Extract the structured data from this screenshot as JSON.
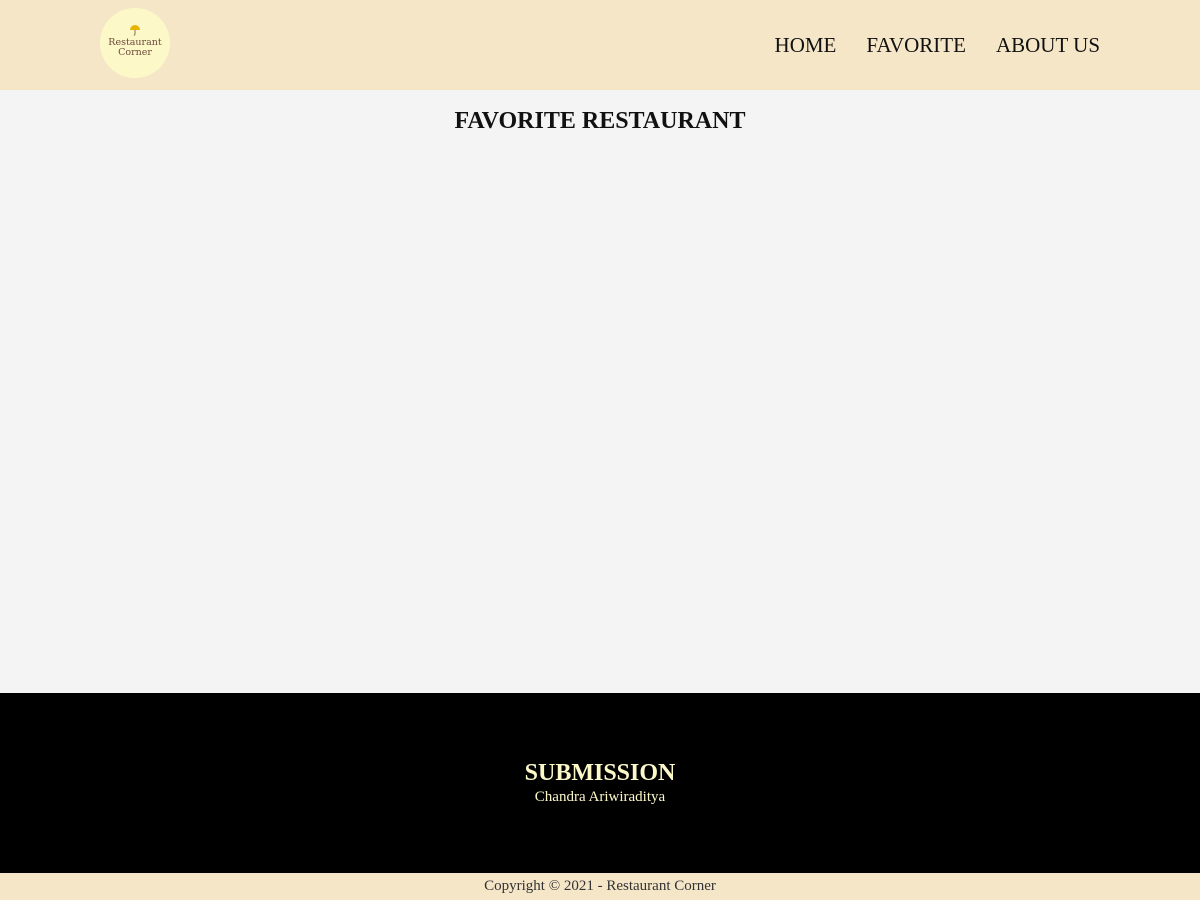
{
  "header": {
    "logo": {
      "line1": "Restaurant",
      "line2": "Corner",
      "icon": "umbrella-icon",
      "bg_color": "#fdf8c8",
      "icon_color": "#e8b400"
    },
    "nav": [
      {
        "label": "HOME"
      },
      {
        "label": "FAVORITE"
      },
      {
        "label": "ABOUT US"
      }
    ],
    "bg_color": "#f5e6c8"
  },
  "main": {
    "title": "FAVORITE RESTAURANT",
    "bg_color": "#f4f4f4"
  },
  "footer": {
    "title": "SUBMISSION",
    "subtitle": "Chandra Ariwiraditya",
    "bg_color": "#000000",
    "text_color": "#fdf8c8"
  },
  "copyright": {
    "text": "Copyright © 2021 - Restaurant Corner"
  }
}
